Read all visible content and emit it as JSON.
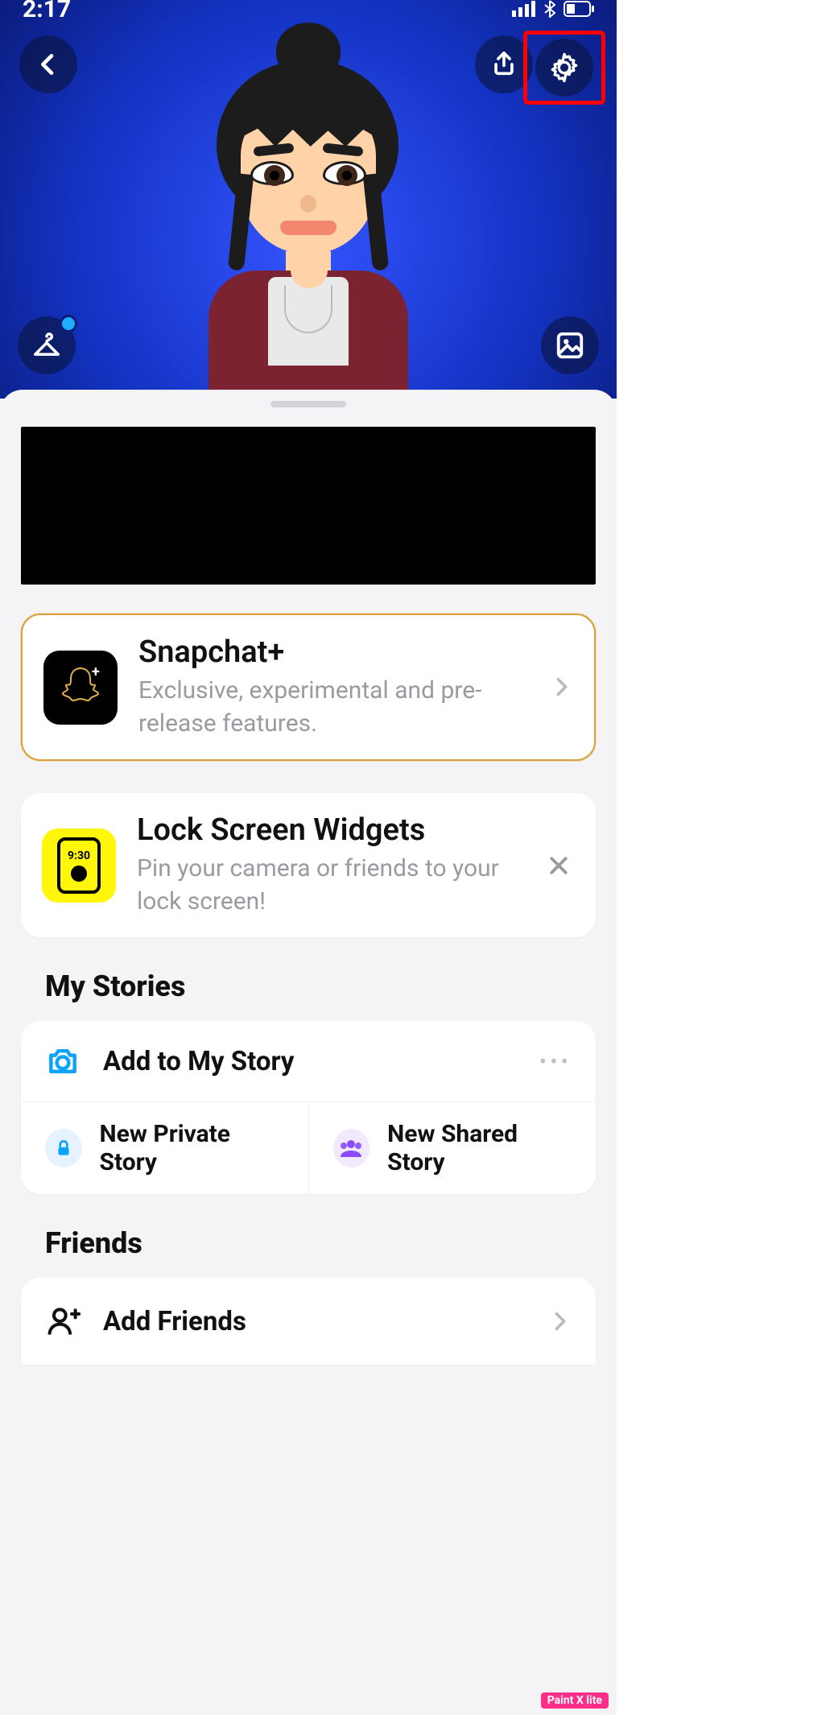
{
  "status": {
    "time": "2:17"
  },
  "header": {
    "icons": {
      "back": "back-icon",
      "share": "share-icon",
      "settings": "gear-icon",
      "outfit": "hanger-icon",
      "background": "picture-icon"
    }
  },
  "promo_plus": {
    "title": "Snapchat+",
    "subtitle": "Exclusive, experimental and pre-release features."
  },
  "promo_widgets": {
    "title": "Lock Screen Widgets",
    "subtitle": "Pin your camera or friends to your lock screen!",
    "badge_time": "9:30"
  },
  "sections": {
    "stories_header": "My Stories",
    "friends_header": "Friends"
  },
  "stories": {
    "add_label": "Add to My Story",
    "private_label": "New Private Story",
    "shared_label": "New Shared Story"
  },
  "friends": {
    "add_label": "Add Friends"
  },
  "watermark": "Paint X lite"
}
